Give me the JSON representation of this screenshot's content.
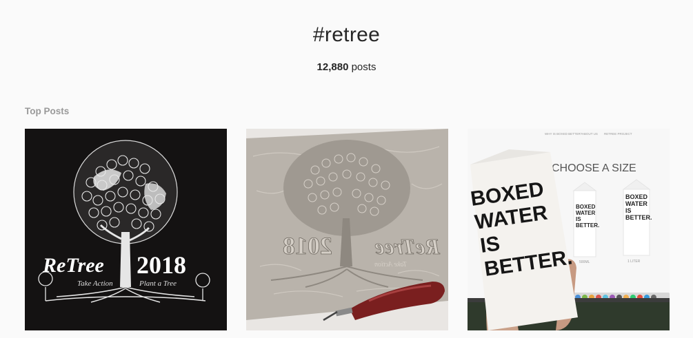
{
  "header": {
    "hashtag": "#retree",
    "post_count": "12,880",
    "post_count_label": "posts"
  },
  "sections": {
    "top_posts_title": "Top Posts"
  },
  "posts": [
    {
      "art_line1": "ReTree",
      "art_year": "2018",
      "art_caption_left": "Take Action",
      "art_caption_right": "Plant a Tree"
    },
    {
      "art_word": "ReTree",
      "art_year": "2018",
      "art_caption": "Take Action"
    },
    {
      "nav": [
        "WHY IS BOXED BETTER?",
        "ABOUT US",
        "RETREE PROJECT"
      ],
      "heading": "CHOOSE A SIZE",
      "carton_big": [
        "BOXED",
        "WATER",
        "IS",
        "BETTER."
      ],
      "carton_small_1": [
        "BOXED",
        "WATER",
        "IS",
        "BETTER."
      ],
      "carton_small_2": [
        "BOXED",
        "WATER",
        "IS",
        "BETTER."
      ],
      "size_1": "500ML",
      "size_2": "1 LITER"
    }
  ]
}
